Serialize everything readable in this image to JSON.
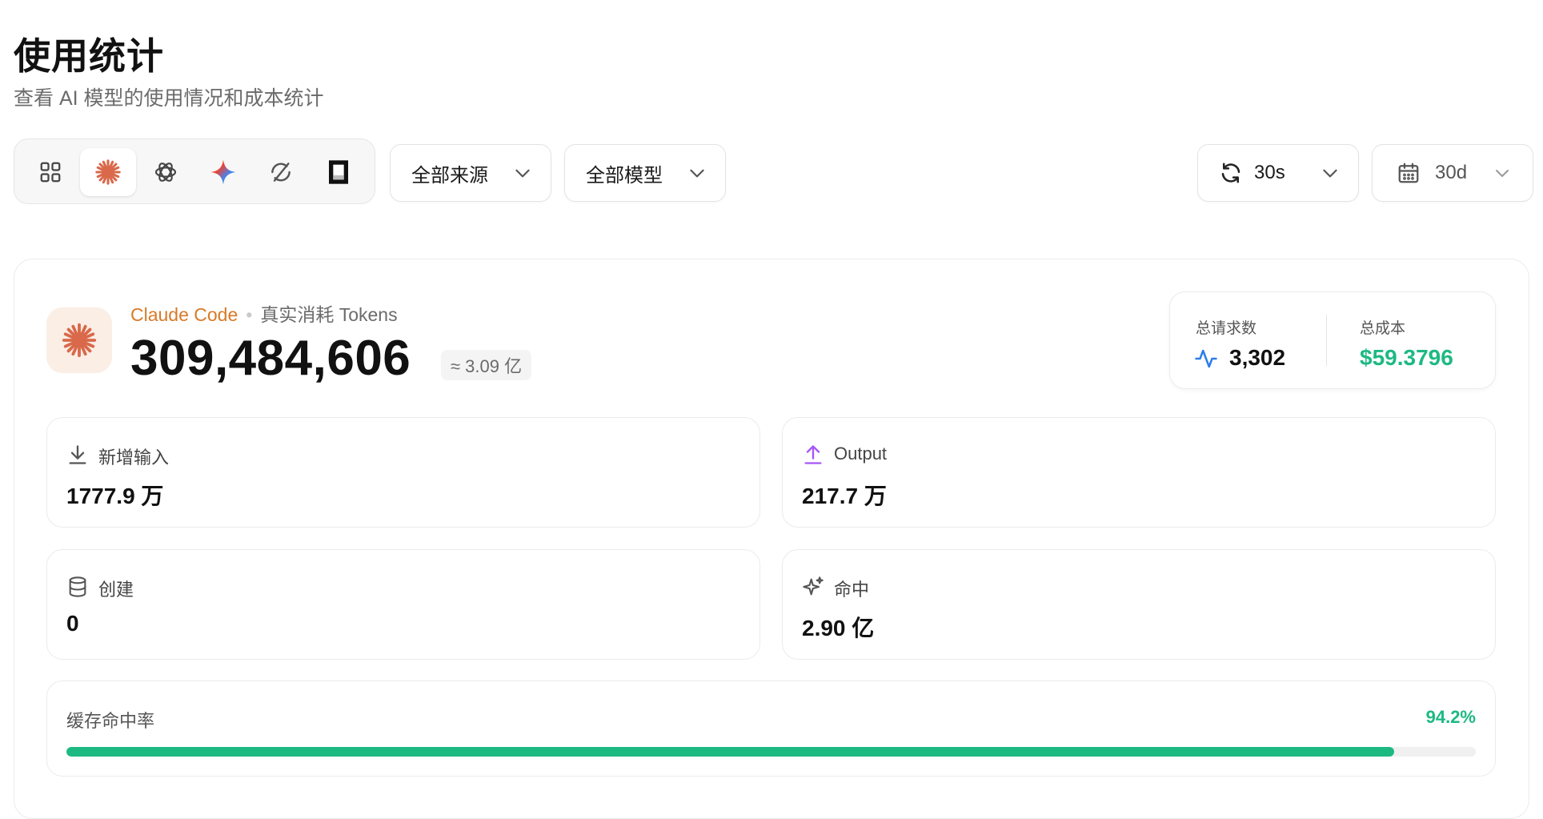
{
  "header": {
    "title": "使用统计",
    "subtitle": "查看 AI 模型的使用情况和成本统计"
  },
  "toolbar": {
    "providers": [
      {
        "icon": "grid-icon",
        "active": false
      },
      {
        "icon": "claude-icon",
        "active": true
      },
      {
        "icon": "openai-icon",
        "active": false
      },
      {
        "icon": "gemini-icon",
        "active": false
      },
      {
        "icon": "sync-off-icon",
        "active": false
      },
      {
        "icon": "terminal-icon",
        "active": false
      }
    ],
    "source_select": "全部来源",
    "model_select": "全部模型",
    "refresh_select": "30s",
    "range_select": "30d"
  },
  "summary": {
    "source": "Claude Code",
    "separator": "•",
    "kind": "真实消耗 Tokens",
    "total_tokens": "309,484,606",
    "approx": "≈ 3.09 亿",
    "requests_label": "总请求数",
    "requests_value": "3,302",
    "cost_label": "总成本",
    "cost_value": "$59.3796"
  },
  "stats": {
    "input_label": "新增输入",
    "input_value": "1777.9 万",
    "output_label": "Output",
    "output_value": "217.7 万",
    "create_label": "创建",
    "create_value": "0",
    "hit_label": "命中",
    "hit_value": "2.90 亿"
  },
  "cache_rate": {
    "label": "缓存命中率",
    "percent_text": "94.2%",
    "fraction": 0.942
  },
  "colors": {
    "accent_orange": "#d97a28",
    "claude_mark": "#d9694a",
    "green": "#1db983",
    "output_purple": "#a855f7",
    "pulse_blue": "#2b7de9"
  }
}
